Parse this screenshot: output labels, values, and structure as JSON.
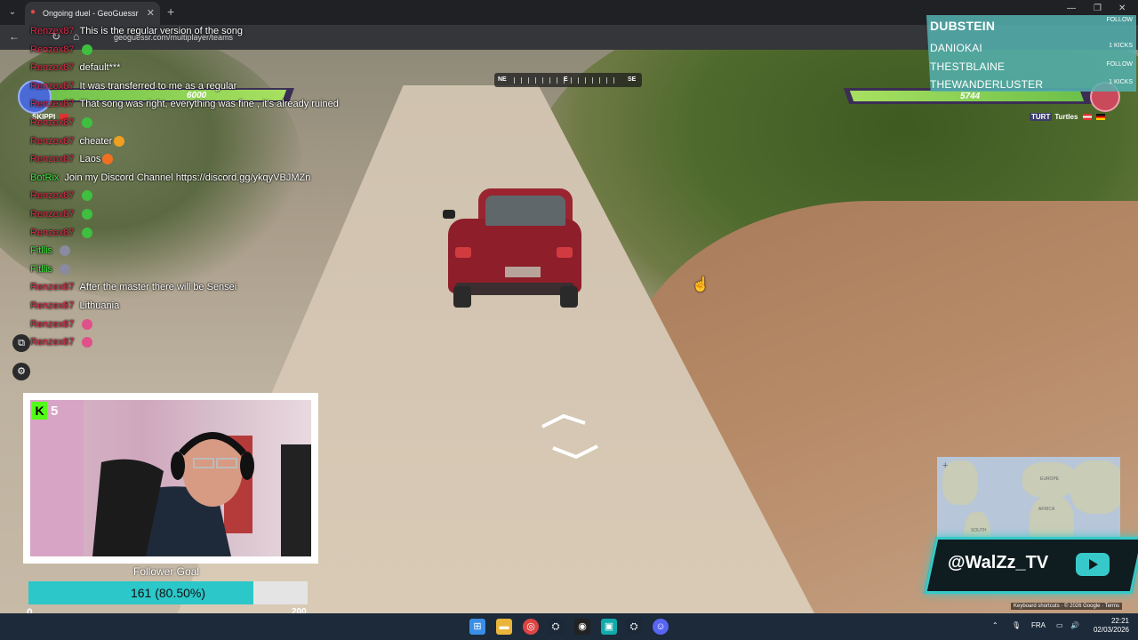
{
  "browser": {
    "tab_title": "Ongoing duel - GeoGuessr",
    "url": "geoguessr.com/multiplayer/teams"
  },
  "compass": {
    "labels": [
      "NE",
      "E",
      "SE"
    ]
  },
  "duel": {
    "left_team": {
      "health": 6000,
      "health_fraction": 0.98,
      "name": "SKIPPI"
    },
    "right_team": {
      "health": 5744,
      "health_fraction": 0.96,
      "tag": "TURT",
      "name": "Turtles"
    }
  },
  "follow_panel": {
    "rows": [
      {
        "name": "DUBSTEIN",
        "meta": "FOLLOW"
      },
      {
        "name": "DANIOKAI",
        "meta": "1 KICKS"
      },
      {
        "name": "THESTBLAINE",
        "meta": "FOLLOW"
      },
      {
        "name": "THEWANDERLUSTER",
        "meta": "1 KICKS"
      }
    ]
  },
  "chat": [
    {
      "user": "Renzex87",
      "user_color": "red",
      "text": "This is the regular version of the song"
    },
    {
      "user": "Renzex87",
      "user_color": "red",
      "text": "",
      "emote": "#3fbf3f"
    },
    {
      "user": "Renzex87",
      "user_color": "red",
      "text": "default***"
    },
    {
      "user": "Renzex87",
      "user_color": "red",
      "text": "It was transferred to me as a regular"
    },
    {
      "user": "Renzex87",
      "user_color": "red",
      "text": "That song was right, everything was fine , it's already ruined"
    },
    {
      "user": "Renzex87",
      "user_color": "red",
      "text": "",
      "emote": "#3fbf3f"
    },
    {
      "user": "Renzex87",
      "user_color": "red",
      "text": "cheater",
      "emote": "#f0a020"
    },
    {
      "user": "Renzex87",
      "user_color": "red",
      "text": "Laos",
      "emote": "#f07020"
    },
    {
      "user": "BotRix",
      "user_color": "green",
      "text": "Join my Discord Channel https://discord.gg/ykqyVBJMZn"
    },
    {
      "user": "Renzex87",
      "user_color": "red",
      "text": "",
      "emote": "#3fbf3f"
    },
    {
      "user": "Renzex87",
      "user_color": "red",
      "text": "",
      "emote": "#3fbf3f"
    },
    {
      "user": "Renzex87",
      "user_color": "red",
      "text": "",
      "emote": "#3fbf3f"
    },
    {
      "user": "Fitllis",
      "user_color": "green",
      "text": "",
      "emote": "#8a8aa0"
    },
    {
      "user": "Fitllis",
      "user_color": "green",
      "text": "",
      "emote": "#8a8aa0"
    },
    {
      "user": "Renzex87",
      "user_color": "red",
      "text": "After the master there will be Sensei"
    },
    {
      "user": "Renzex87",
      "user_color": "red",
      "text": "Lithuania"
    },
    {
      "user": "Renzex87",
      "user_color": "red",
      "text": "",
      "emote": "#e0508a"
    },
    {
      "user": "Renzex87",
      "user_color": "red",
      "text": "",
      "emote": "#e0508a"
    }
  ],
  "webcam": {
    "kick_count": "5"
  },
  "follower_goal": {
    "title": "Follower Goal",
    "progress_text": "161 (80.50%)",
    "progress_fraction": 0.805,
    "min": "0",
    "max": "200"
  },
  "map": {
    "labels": [
      "EUROPE",
      "AFRICA",
      "SOUTH"
    ],
    "footer": "Keyboard shortcuts · © 2026 Google · Terms"
  },
  "overlay": {
    "youtube_handle": "@WalZz_TV"
  },
  "taskbar": {
    "language": "FRA",
    "time": "22:21",
    "date": "02/03/2026"
  },
  "colors": {
    "accent_teal": "#37c9c9",
    "kick_green": "#53fc18",
    "health_green": "#8fd457"
  }
}
